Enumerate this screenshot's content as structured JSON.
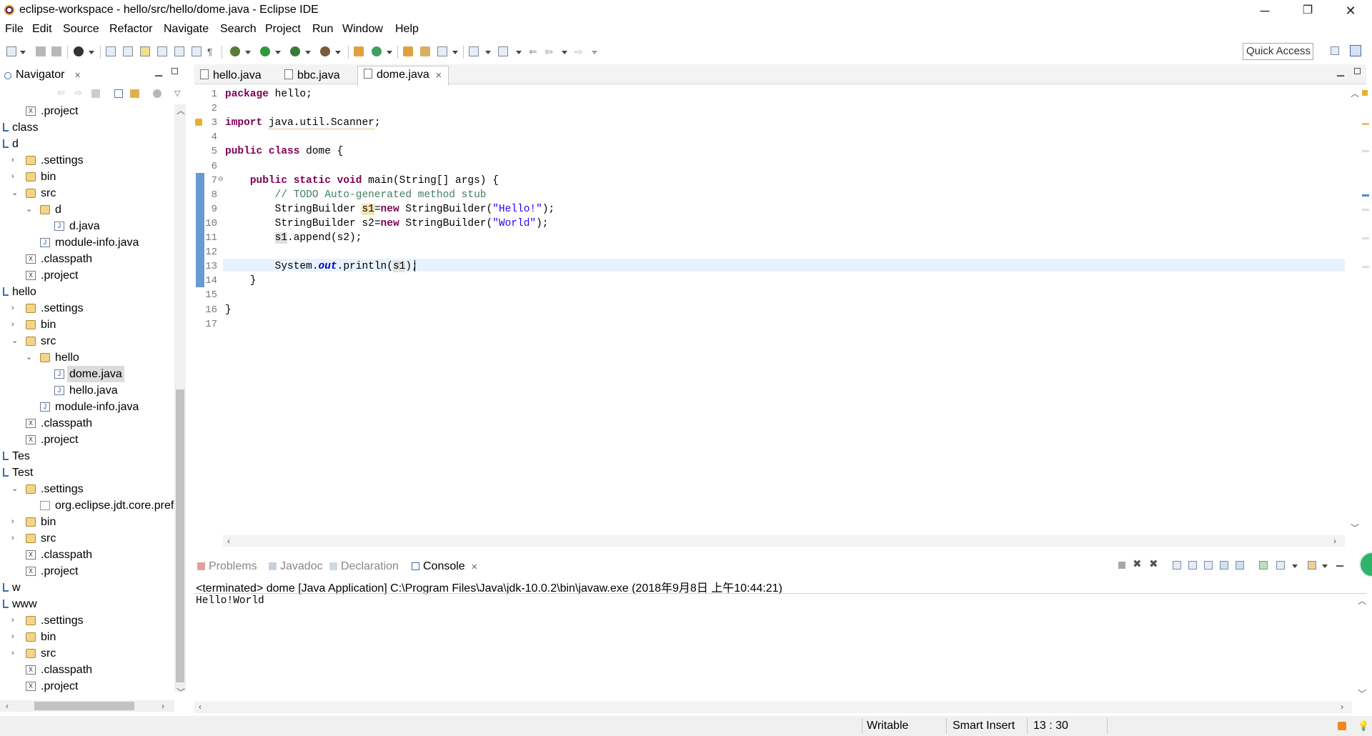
{
  "window": {
    "title": "eclipse-workspace - hello/src/hello/dome.java - Eclipse IDE",
    "minimize": "─",
    "restore": "❐",
    "close": "✕"
  },
  "menu": [
    "File",
    "Edit",
    "Source",
    "Refactor",
    "Navigate",
    "Search",
    "Project",
    "Run",
    "Window",
    "Help"
  ],
  "toolbar": {
    "quick_access": "Quick Access"
  },
  "navigator": {
    "tab_label": "Navigator",
    "tab_close": "✕",
    "tree": [
      {
        "label": ".project",
        "icon": "xfile",
        "depth": 1,
        "arrow": ""
      },
      {
        "label": "class",
        "icon": "project",
        "depth": 0,
        "arrow": ""
      },
      {
        "label": "d",
        "icon": "project",
        "depth": 0,
        "arrow": ""
      },
      {
        "label": ".settings",
        "icon": "folder",
        "depth": 1,
        "arrow": "›"
      },
      {
        "label": "bin",
        "icon": "folder",
        "depth": 1,
        "arrow": "›"
      },
      {
        "label": "src",
        "icon": "folder",
        "depth": 1,
        "arrow": "⌄"
      },
      {
        "label": "d",
        "icon": "folder",
        "depth": 2,
        "arrow": "⌄"
      },
      {
        "label": "d.java",
        "icon": "java",
        "depth": 3,
        "arrow": ""
      },
      {
        "label": "module-info.java",
        "icon": "java",
        "depth": 2,
        "arrow": ""
      },
      {
        "label": ".classpath",
        "icon": "xfile",
        "depth": 1,
        "arrow": ""
      },
      {
        "label": ".project",
        "icon": "xfile",
        "depth": 1,
        "arrow": ""
      },
      {
        "label": "hello",
        "icon": "project",
        "depth": 0,
        "arrow": ""
      },
      {
        "label": ".settings",
        "icon": "folder",
        "depth": 1,
        "arrow": "›"
      },
      {
        "label": "bin",
        "icon": "folder",
        "depth": 1,
        "arrow": "›"
      },
      {
        "label": "src",
        "icon": "folder",
        "depth": 1,
        "arrow": "⌄"
      },
      {
        "label": "hello",
        "icon": "folder",
        "depth": 2,
        "arrow": "⌄"
      },
      {
        "label": "dome.java",
        "icon": "java",
        "depth": 3,
        "arrow": "",
        "selected": true
      },
      {
        "label": "hello.java",
        "icon": "java",
        "depth": 3,
        "arrow": ""
      },
      {
        "label": "module-info.java",
        "icon": "java",
        "depth": 2,
        "arrow": ""
      },
      {
        "label": ".classpath",
        "icon": "xfile",
        "depth": 1,
        "arrow": ""
      },
      {
        "label": ".project",
        "icon": "xfile",
        "depth": 1,
        "arrow": ""
      },
      {
        "label": "Tes",
        "icon": "project",
        "depth": 0,
        "arrow": ""
      },
      {
        "label": "Test",
        "icon": "project",
        "depth": 0,
        "arrow": ""
      },
      {
        "label": ".settings",
        "icon": "folder",
        "depth": 1,
        "arrow": "⌄"
      },
      {
        "label": "org.eclipse.jdt.core.prefs",
        "icon": "pref",
        "depth": 2,
        "arrow": ""
      },
      {
        "label": "bin",
        "icon": "folder",
        "depth": 1,
        "arrow": "›"
      },
      {
        "label": "src",
        "icon": "folder",
        "depth": 1,
        "arrow": "›"
      },
      {
        "label": ".classpath",
        "icon": "xfile",
        "depth": 1,
        "arrow": ""
      },
      {
        "label": ".project",
        "icon": "xfile",
        "depth": 1,
        "arrow": ""
      },
      {
        "label": "w",
        "icon": "project",
        "depth": 0,
        "arrow": ""
      },
      {
        "label": "www",
        "icon": "project",
        "depth": 0,
        "arrow": ""
      },
      {
        "label": ".settings",
        "icon": "folder",
        "depth": 1,
        "arrow": "›"
      },
      {
        "label": "bin",
        "icon": "folder",
        "depth": 1,
        "arrow": "›"
      },
      {
        "label": "src",
        "icon": "folder",
        "depth": 1,
        "arrow": "›"
      },
      {
        "label": ".classpath",
        "icon": "xfile",
        "depth": 1,
        "arrow": ""
      },
      {
        "label": ".project",
        "icon": "xfile",
        "depth": 1,
        "arrow": ""
      }
    ]
  },
  "editor": {
    "tabs": [
      {
        "label": "hello.java",
        "active": false
      },
      {
        "label": "bbc.java",
        "active": false
      },
      {
        "label": "dome.java",
        "active": true,
        "close": "✕"
      }
    ],
    "lines": [
      {
        "num": "1",
        "html": "<span class='kw'>package</span> hello;"
      },
      {
        "num": "2",
        "html": ""
      },
      {
        "num": "3",
        "html": "<span class='kw'>import</span> <span class='warn-ul'>java.util.Scanner</span>;"
      },
      {
        "num": "4",
        "html": ""
      },
      {
        "num": "5",
        "html": "<span class='kw'>public</span> <span class='kw'>class</span> dome {"
      },
      {
        "num": "6",
        "html": ""
      },
      {
        "num": "7",
        "html": "    <span class='kw'>public</span> <span class='kw'>static</span> <span class='kw'>void</span> main(String[] args) {"
      },
      {
        "num": "8",
        "html": "        <span class='cmt'>// TODO Auto-generated method stub</span>"
      },
      {
        "num": "9",
        "html": "        StringBuilder <span class='occ'>s1</span>=<span class='kw'>new</span> StringBuilder(<span class='str'>\"Hello!\"</span>);"
      },
      {
        "num": "10",
        "html": "        StringBuilder s2=<span class='kw'>new</span> StringBuilder(<span class='str'>\"World\"</span>);"
      },
      {
        "num": "11",
        "html": "        <span class='occ2'>s1</span>.append(s2);"
      },
      {
        "num": "12",
        "html": ""
      },
      {
        "num": "13",
        "html": "        System.<span class='fld'>out</span>.println(<span class='occ2'>s1</span>);"
      },
      {
        "num": "14",
        "html": "    }"
      },
      {
        "num": "15",
        "html": ""
      },
      {
        "num": "16",
        "html": "}"
      },
      {
        "num": "17",
        "html": ""
      }
    ]
  },
  "console": {
    "tabs": [
      {
        "label": "Problems",
        "active": false
      },
      {
        "label": "Javadoc",
        "active": false
      },
      {
        "label": "Declaration",
        "active": false
      },
      {
        "label": "Console",
        "active": true
      }
    ],
    "close": "✕",
    "status": "<terminated> dome [Java Application] C:\\Program Files\\Java\\jdk-10.0.2\\bin\\javaw.exe (2018年9月8日 上午10:44:21)",
    "output": "Hello!World"
  },
  "statusbar": {
    "writable": "Writable",
    "insert_mode": "Smart Insert",
    "position": "13 : 30"
  },
  "colors": {
    "keyword": "#7f0055",
    "string": "#2a00ff",
    "comment": "#3f7f5f",
    "current_line": "#e8f2fe",
    "ruler": "#4f88c8"
  }
}
